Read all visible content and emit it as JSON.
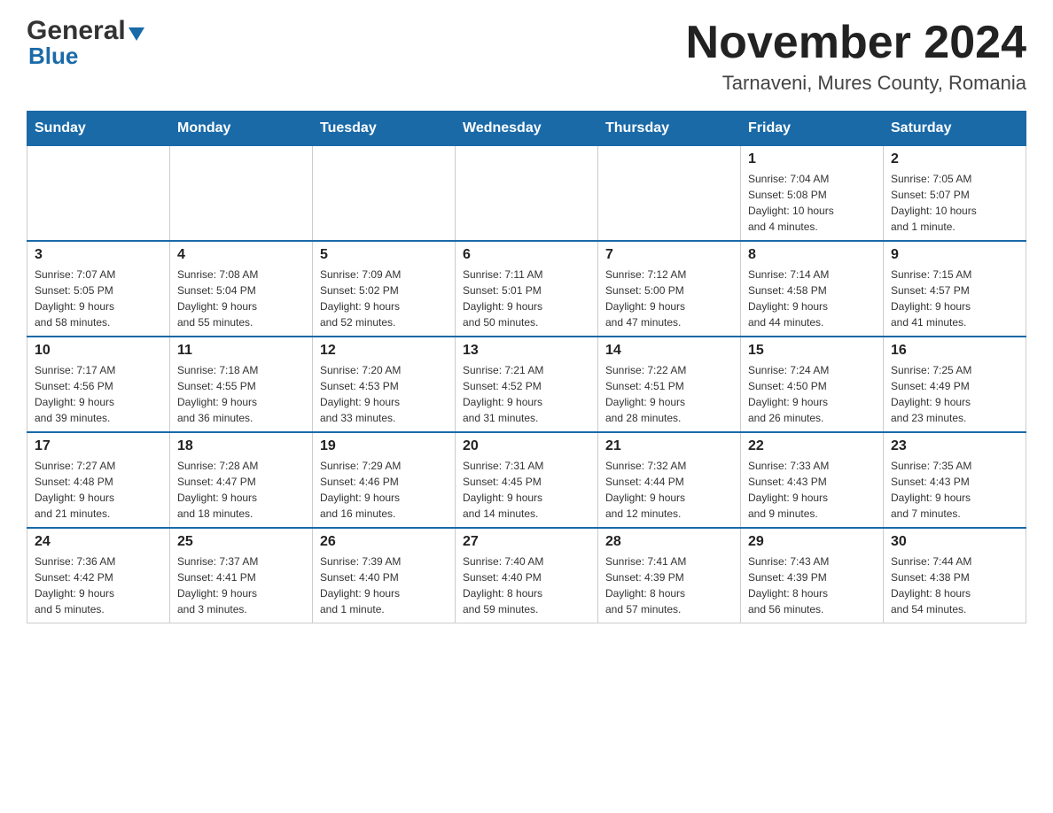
{
  "logo": {
    "general": "General",
    "triangle": "▶",
    "blue": "Blue"
  },
  "title": "November 2024",
  "subtitle": "Tarnaveni, Mures County, Romania",
  "days_of_week": [
    "Sunday",
    "Monday",
    "Tuesday",
    "Wednesday",
    "Thursday",
    "Friday",
    "Saturday"
  ],
  "weeks": [
    [
      {
        "day": "",
        "info": ""
      },
      {
        "day": "",
        "info": ""
      },
      {
        "day": "",
        "info": ""
      },
      {
        "day": "",
        "info": ""
      },
      {
        "day": "",
        "info": ""
      },
      {
        "day": "1",
        "info": "Sunrise: 7:04 AM\nSunset: 5:08 PM\nDaylight: 10 hours\nand 4 minutes."
      },
      {
        "day": "2",
        "info": "Sunrise: 7:05 AM\nSunset: 5:07 PM\nDaylight: 10 hours\nand 1 minute."
      }
    ],
    [
      {
        "day": "3",
        "info": "Sunrise: 7:07 AM\nSunset: 5:05 PM\nDaylight: 9 hours\nand 58 minutes."
      },
      {
        "day": "4",
        "info": "Sunrise: 7:08 AM\nSunset: 5:04 PM\nDaylight: 9 hours\nand 55 minutes."
      },
      {
        "day": "5",
        "info": "Sunrise: 7:09 AM\nSunset: 5:02 PM\nDaylight: 9 hours\nand 52 minutes."
      },
      {
        "day": "6",
        "info": "Sunrise: 7:11 AM\nSunset: 5:01 PM\nDaylight: 9 hours\nand 50 minutes."
      },
      {
        "day": "7",
        "info": "Sunrise: 7:12 AM\nSunset: 5:00 PM\nDaylight: 9 hours\nand 47 minutes."
      },
      {
        "day": "8",
        "info": "Sunrise: 7:14 AM\nSunset: 4:58 PM\nDaylight: 9 hours\nand 44 minutes."
      },
      {
        "day": "9",
        "info": "Sunrise: 7:15 AM\nSunset: 4:57 PM\nDaylight: 9 hours\nand 41 minutes."
      }
    ],
    [
      {
        "day": "10",
        "info": "Sunrise: 7:17 AM\nSunset: 4:56 PM\nDaylight: 9 hours\nand 39 minutes."
      },
      {
        "day": "11",
        "info": "Sunrise: 7:18 AM\nSunset: 4:55 PM\nDaylight: 9 hours\nand 36 minutes."
      },
      {
        "day": "12",
        "info": "Sunrise: 7:20 AM\nSunset: 4:53 PM\nDaylight: 9 hours\nand 33 minutes."
      },
      {
        "day": "13",
        "info": "Sunrise: 7:21 AM\nSunset: 4:52 PM\nDaylight: 9 hours\nand 31 minutes."
      },
      {
        "day": "14",
        "info": "Sunrise: 7:22 AM\nSunset: 4:51 PM\nDaylight: 9 hours\nand 28 minutes."
      },
      {
        "day": "15",
        "info": "Sunrise: 7:24 AM\nSunset: 4:50 PM\nDaylight: 9 hours\nand 26 minutes."
      },
      {
        "day": "16",
        "info": "Sunrise: 7:25 AM\nSunset: 4:49 PM\nDaylight: 9 hours\nand 23 minutes."
      }
    ],
    [
      {
        "day": "17",
        "info": "Sunrise: 7:27 AM\nSunset: 4:48 PM\nDaylight: 9 hours\nand 21 minutes."
      },
      {
        "day": "18",
        "info": "Sunrise: 7:28 AM\nSunset: 4:47 PM\nDaylight: 9 hours\nand 18 minutes."
      },
      {
        "day": "19",
        "info": "Sunrise: 7:29 AM\nSunset: 4:46 PM\nDaylight: 9 hours\nand 16 minutes."
      },
      {
        "day": "20",
        "info": "Sunrise: 7:31 AM\nSunset: 4:45 PM\nDaylight: 9 hours\nand 14 minutes."
      },
      {
        "day": "21",
        "info": "Sunrise: 7:32 AM\nSunset: 4:44 PM\nDaylight: 9 hours\nand 12 minutes."
      },
      {
        "day": "22",
        "info": "Sunrise: 7:33 AM\nSunset: 4:43 PM\nDaylight: 9 hours\nand 9 minutes."
      },
      {
        "day": "23",
        "info": "Sunrise: 7:35 AM\nSunset: 4:43 PM\nDaylight: 9 hours\nand 7 minutes."
      }
    ],
    [
      {
        "day": "24",
        "info": "Sunrise: 7:36 AM\nSunset: 4:42 PM\nDaylight: 9 hours\nand 5 minutes."
      },
      {
        "day": "25",
        "info": "Sunrise: 7:37 AM\nSunset: 4:41 PM\nDaylight: 9 hours\nand 3 minutes."
      },
      {
        "day": "26",
        "info": "Sunrise: 7:39 AM\nSunset: 4:40 PM\nDaylight: 9 hours\nand 1 minute."
      },
      {
        "day": "27",
        "info": "Sunrise: 7:40 AM\nSunset: 4:40 PM\nDaylight: 8 hours\nand 59 minutes."
      },
      {
        "day": "28",
        "info": "Sunrise: 7:41 AM\nSunset: 4:39 PM\nDaylight: 8 hours\nand 57 minutes."
      },
      {
        "day": "29",
        "info": "Sunrise: 7:43 AM\nSunset: 4:39 PM\nDaylight: 8 hours\nand 56 minutes."
      },
      {
        "day": "30",
        "info": "Sunrise: 7:44 AM\nSunset: 4:38 PM\nDaylight: 8 hours\nand 54 minutes."
      }
    ]
  ]
}
